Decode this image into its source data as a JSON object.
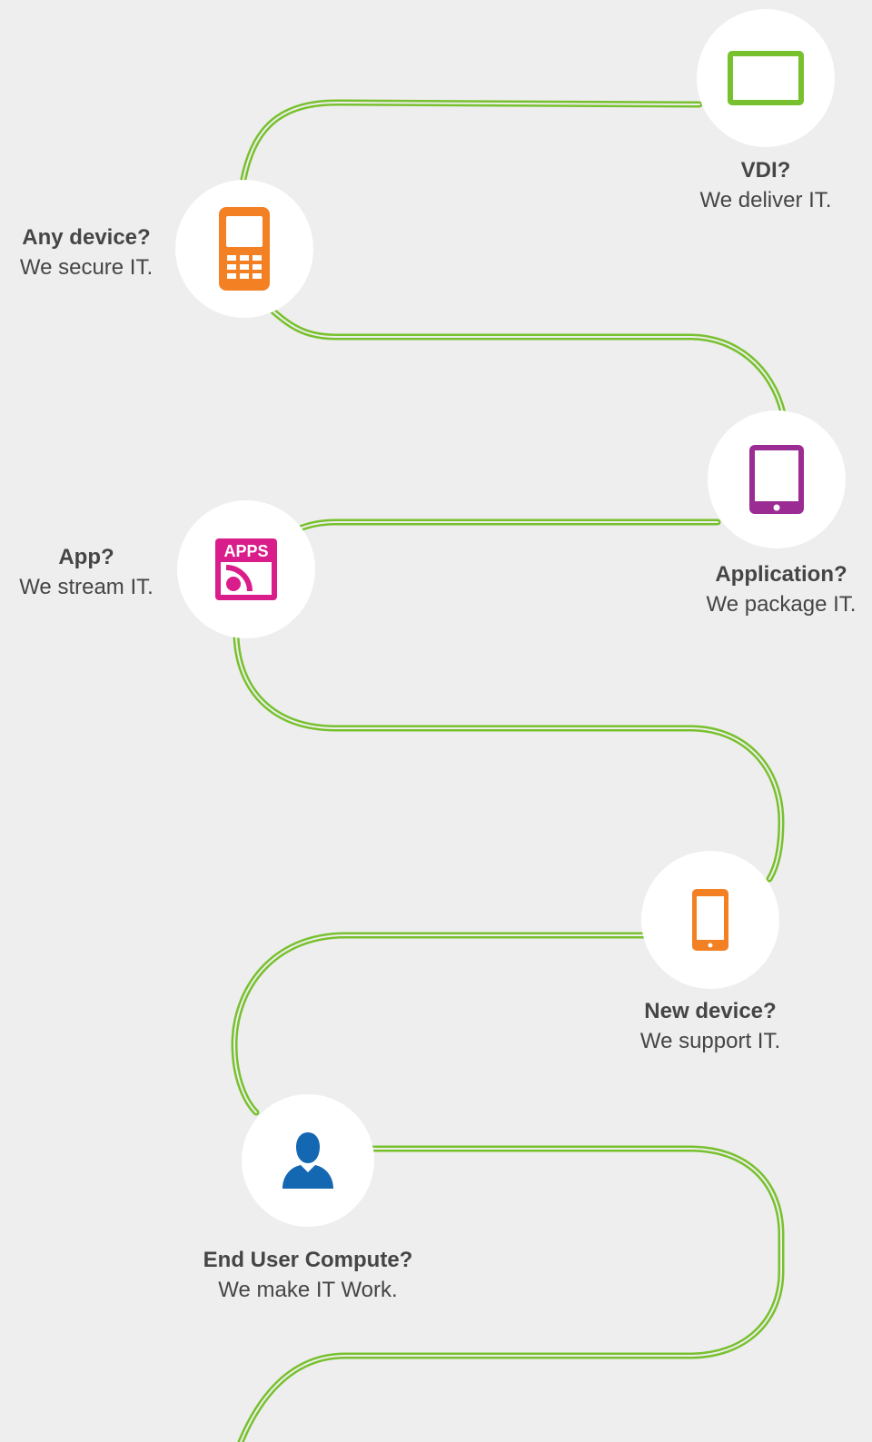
{
  "colors": {
    "path_green": "#78c12e",
    "background": "#eeeeee",
    "circle_fill": "#ffffff",
    "text": "#454545",
    "orange": "#f38023",
    "purple": "#9b2c93",
    "magenta": "#d91d8a",
    "blue": "#1467b1"
  },
  "milestones": [
    {
      "id": "vdi",
      "title": "VDI?",
      "subtitle": "We deliver IT.",
      "icon": "monitor-icon",
      "icon_color": "#78c12e"
    },
    {
      "id": "any-device",
      "title": "Any device?",
      "subtitle": "We secure IT.",
      "icon": "mobile-phone-icon",
      "icon_color": "#f38023"
    },
    {
      "id": "application",
      "title": "Application?",
      "subtitle": "We package IT.",
      "icon": "tablet-icon",
      "icon_color": "#9b2c93"
    },
    {
      "id": "app",
      "title": "App?",
      "subtitle": "We stream IT.",
      "icon": "apps-stream-icon",
      "icon_color": "#d91d8a",
      "icon_text": "APPS"
    },
    {
      "id": "new-device",
      "title": "New device?",
      "subtitle": "We support IT.",
      "icon": "smartphone-icon",
      "icon_color": "#f38023"
    },
    {
      "id": "end-user",
      "title": "End User Compute?",
      "subtitle": "We make IT Work.",
      "icon": "user-icon",
      "icon_color": "#1467b1"
    }
  ]
}
